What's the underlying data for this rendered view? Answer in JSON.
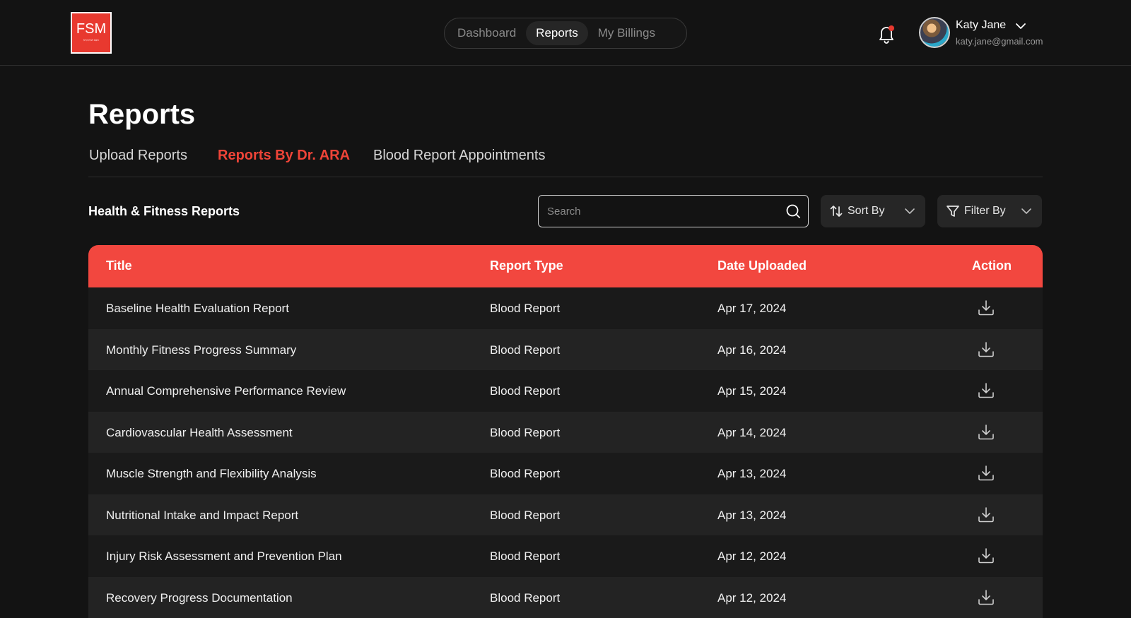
{
  "brand": {
    "logo_text": "FSM",
    "logo_tagline": "ᎦᎢᎩᏁᏚᏒ ᏝᏜᎭ",
    "accent_color": "#ef4438"
  },
  "nav": {
    "items": [
      {
        "label": "Dashboard",
        "active": false
      },
      {
        "label": "Reports",
        "active": true
      },
      {
        "label": "My Billings",
        "active": false
      }
    ]
  },
  "user": {
    "name": "Katy Jane",
    "email": "katy.jane@gmail.com",
    "has_notification": true
  },
  "page": {
    "title": "Reports",
    "tabs": [
      {
        "label": "Upload Reports",
        "active": false
      },
      {
        "label": "Reports By Dr. ARA",
        "active": true
      },
      {
        "label": "Blood Report Appointments",
        "active": false
      }
    ]
  },
  "toolbar": {
    "section_title": "Health & Fitness Reports",
    "search_placeholder": "Search",
    "sort_label": "Sort By",
    "filter_label": "Filter By"
  },
  "table": {
    "columns": [
      "Title",
      "Report Type",
      "Date Uploaded",
      "Action"
    ],
    "rows": [
      {
        "title": "Baseline Health Evaluation Report",
        "type": "Blood Report",
        "date": "Apr 17, 2024"
      },
      {
        "title": "Monthly Fitness Progress Summary",
        "type": "Blood Report",
        "date": "Apr 16, 2024"
      },
      {
        "title": "Annual Comprehensive Performance Review",
        "type": "Blood Report",
        "date": "Apr 15, 2024"
      },
      {
        "title": "Cardiovascular Health Assessment",
        "type": "Blood Report",
        "date": "Apr 14, 2024"
      },
      {
        "title": "Muscle Strength and Flexibility Analysis",
        "type": "Blood Report",
        "date": "Apr 13, 2024"
      },
      {
        "title": "Nutritional Intake and Impact Report",
        "type": "Blood Report",
        "date": "Apr 13, 2024"
      },
      {
        "title": "Injury Risk Assessment and Prevention Plan",
        "type": "Blood Report",
        "date": "Apr 12, 2024"
      },
      {
        "title": "Recovery Progress Documentation",
        "type": "Blood Report",
        "date": "Apr 12, 2024"
      }
    ]
  }
}
